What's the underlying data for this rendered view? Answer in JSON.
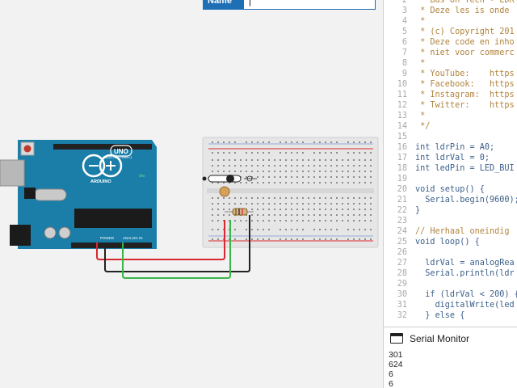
{
  "name_field": {
    "label": "Name",
    "value": "|"
  },
  "board": {
    "brand": "ARDUINO",
    "model": "UNO",
    "label_digital": "DIGITAL (PWM~)",
    "label_power": "POWER",
    "label_analog": "ANALOG IN",
    "label_on": "ON"
  },
  "colors": {
    "board": "#1a7ea8",
    "wire_red": "#d9292f",
    "wire_black": "#222222",
    "wire_green": "#39b54a",
    "breadboard": "#e6e6e6",
    "accent": "#1f6fb4"
  },
  "code_lines": [
    {
      "n": "2",
      "text": " * Bas on Tech - LDR",
      "kind": "comment"
    },
    {
      "n": "3",
      "text": " * Deze les is onde",
      "kind": "comment"
    },
    {
      "n": "4",
      "text": " *",
      "kind": "comment"
    },
    {
      "n": "5",
      "text": " * (c) Copyright 201",
      "kind": "comment"
    },
    {
      "n": "6",
      "text": " * Deze code en inho",
      "kind": "comment"
    },
    {
      "n": "7",
      "text": " * niet voor commerc",
      "kind": "comment"
    },
    {
      "n": "8",
      "text": " *",
      "kind": "comment"
    },
    {
      "n": "9",
      "text": " * YouTube:    https",
      "kind": "comment"
    },
    {
      "n": "10",
      "text": " * Facebook:   https",
      "kind": "comment"
    },
    {
      "n": "11",
      "text": " * Instagram:  https",
      "kind": "comment"
    },
    {
      "n": "12",
      "text": " * Twitter:    https",
      "kind": "comment"
    },
    {
      "n": "13",
      "text": " *",
      "kind": "comment"
    },
    {
      "n": "14",
      "text": " */",
      "kind": "comment"
    },
    {
      "n": "15",
      "text": "",
      "kind": "blank"
    },
    {
      "n": "16",
      "text": "int ldrPin = A0;",
      "kind": "code"
    },
    {
      "n": "17",
      "text": "int ldrVal = 0;",
      "kind": "code"
    },
    {
      "n": "18",
      "text": "int ledPin = LED_BUI",
      "kind": "code"
    },
    {
      "n": "19",
      "text": "",
      "kind": "blank"
    },
    {
      "n": "20",
      "text": "void setup() {",
      "kind": "code"
    },
    {
      "n": "21",
      "text": "  Serial.begin(9600);",
      "kind": "code"
    },
    {
      "n": "22",
      "text": "}",
      "kind": "code"
    },
    {
      "n": "23",
      "text": "",
      "kind": "blank"
    },
    {
      "n": "24",
      "text": "// Herhaal oneindig",
      "kind": "comment"
    },
    {
      "n": "25",
      "text": "void loop() {",
      "kind": "code"
    },
    {
      "n": "26",
      "text": "",
      "kind": "blank"
    },
    {
      "n": "27",
      "text": "  ldrVal = analogRea",
      "kind": "code"
    },
    {
      "n": "28",
      "text": "  Serial.println(ldr",
      "kind": "code"
    },
    {
      "n": "29",
      "text": "",
      "kind": "blank"
    },
    {
      "n": "30",
      "text": "  if (ldrVal < 200) {",
      "kind": "code"
    },
    {
      "n": "31",
      "text": "    digitalWrite(led",
      "kind": "code"
    },
    {
      "n": "32",
      "text": "  } else {",
      "kind": "code"
    }
  ],
  "serial_monitor": {
    "title": "Serial Monitor",
    "icon": "serial-monitor-icon",
    "lines": [
      "301",
      "624",
      "6",
      "6"
    ]
  }
}
